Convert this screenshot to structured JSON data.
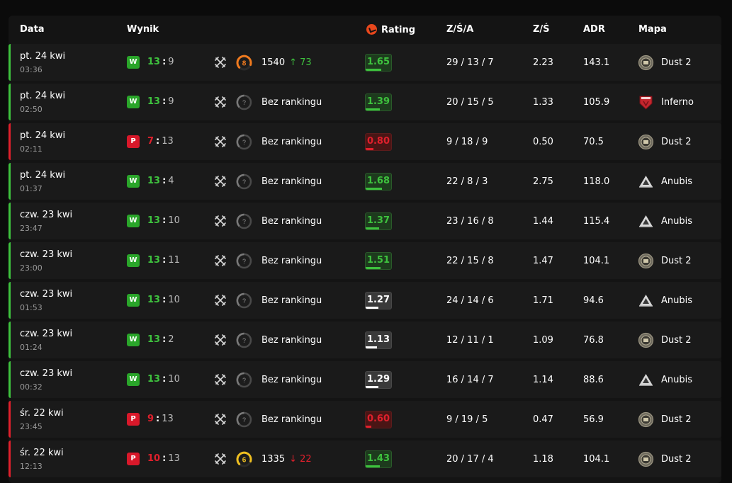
{
  "header": {
    "date": "Data",
    "result": "Wynik",
    "rating": "Rating",
    "kda": "Z/Ś/A",
    "kd": "Z/Ś",
    "adr": "ADR",
    "map": "Mapa"
  },
  "colors": {
    "win": "#3ec23e",
    "loss": "#e0202c",
    "rank_8": "#f07a1e",
    "rank_6": "#f0c020",
    "background": "#0b0b0b",
    "row": "#1a1a1a"
  },
  "matches": [
    {
      "outcome": "win",
      "badge": "W",
      "date": "pt. 24 kwi",
      "time": "03:36",
      "own": "13",
      "opp": "9",
      "ranked": true,
      "rank_level": "8",
      "elo": "1540",
      "elo_change": "↑ 73",
      "elo_dir": "up",
      "rating": "1.65",
      "rating_class": "good",
      "rating_fill": 0.62,
      "kda": "29 / 13 / 7",
      "kd": "2.23",
      "adr": "143.1",
      "map": "Dust 2",
      "map_icon": "dust2-icon"
    },
    {
      "outcome": "win",
      "badge": "W",
      "date": "pt. 24 kwi",
      "time": "02:50",
      "own": "13",
      "opp": "9",
      "ranked": false,
      "rank_text": "Bez rankingu",
      "rating": "1.39",
      "rating_class": "good",
      "rating_fill": 0.55,
      "kda": "20 / 15 / 5",
      "kd": "1.33",
      "adr": "105.9",
      "map": "Inferno",
      "map_icon": "inferno-icon"
    },
    {
      "outcome": "loss",
      "badge": "P",
      "date": "pt. 24 kwi",
      "time": "02:11",
      "own": "7",
      "opp": "13",
      "ranked": false,
      "rank_text": "Bez rankingu",
      "rating": "0.80",
      "rating_class": "bad",
      "rating_fill": 0.3,
      "kda": "9 / 18 / 9",
      "kd": "0.50",
      "adr": "70.5",
      "map": "Dust 2",
      "map_icon": "dust2-icon"
    },
    {
      "outcome": "win",
      "badge": "W",
      "date": "pt. 24 kwi",
      "time": "01:37",
      "own": "13",
      "opp": "4",
      "ranked": false,
      "rank_text": "Bez rankingu",
      "rating": "1.68",
      "rating_class": "good",
      "rating_fill": 0.63,
      "kda": "22 / 8 / 3",
      "kd": "2.75",
      "adr": "118.0",
      "map": "Anubis",
      "map_icon": "anubis-icon"
    },
    {
      "outcome": "win",
      "badge": "W",
      "date": "czw. 23 kwi",
      "time": "23:47",
      "own": "13",
      "opp": "10",
      "ranked": false,
      "rank_text": "Bez rankingu",
      "rating": "1.37",
      "rating_class": "good",
      "rating_fill": 0.54,
      "kda": "23 / 16 / 8",
      "kd": "1.44",
      "adr": "115.4",
      "map": "Anubis",
      "map_icon": "anubis-icon"
    },
    {
      "outcome": "win",
      "badge": "W",
      "date": "czw. 23 kwi",
      "time": "23:00",
      "own": "13",
      "opp": "11",
      "ranked": false,
      "rank_text": "Bez rankingu",
      "rating": "1.51",
      "rating_class": "good",
      "rating_fill": 0.58,
      "kda": "22 / 15 / 8",
      "kd": "1.47",
      "adr": "104.1",
      "map": "Dust 2",
      "map_icon": "dust2-icon"
    },
    {
      "outcome": "win",
      "badge": "W",
      "date": "czw. 23 kwi",
      "time": "01:53",
      "own": "13",
      "opp": "10",
      "ranked": false,
      "rank_text": "Bez rankingu",
      "rating": "1.27",
      "rating_class": "neutral",
      "rating_fill": 0.5,
      "kda": "24 / 14 / 6",
      "kd": "1.71",
      "adr": "94.6",
      "map": "Anubis",
      "map_icon": "anubis-icon"
    },
    {
      "outcome": "win",
      "badge": "W",
      "date": "czw. 23 kwi",
      "time": "01:24",
      "own": "13",
      "opp": "2",
      "ranked": false,
      "rank_text": "Bez rankingu",
      "rating": "1.13",
      "rating_class": "neutral",
      "rating_fill": 0.45,
      "kda": "12 / 11 / 1",
      "kd": "1.09",
      "adr": "76.8",
      "map": "Dust 2",
      "map_icon": "dust2-icon"
    },
    {
      "outcome": "win",
      "badge": "W",
      "date": "czw. 23 kwi",
      "time": "00:32",
      "own": "13",
      "opp": "10",
      "ranked": false,
      "rank_text": "Bez rankingu",
      "rating": "1.29",
      "rating_class": "neutral",
      "rating_fill": 0.5,
      "kda": "16 / 14 / 7",
      "kd": "1.14",
      "adr": "88.6",
      "map": "Anubis",
      "map_icon": "anubis-icon"
    },
    {
      "outcome": "loss",
      "badge": "P",
      "date": "śr. 22 kwi",
      "time": "23:45",
      "own": "9",
      "opp": "13",
      "ranked": false,
      "rank_text": "Bez rankingu",
      "rating": "0.60",
      "rating_class": "bad",
      "rating_fill": 0.22,
      "kda": "9 / 19 / 5",
      "kd": "0.47",
      "adr": "56.9",
      "map": "Dust 2",
      "map_icon": "dust2-icon"
    },
    {
      "outcome": "loss",
      "badge": "P",
      "date": "śr. 22 kwi",
      "time": "12:13",
      "own": "10",
      "opp": "13",
      "ranked": true,
      "rank_level": "6",
      "elo": "1335",
      "elo_change": "↓ 22",
      "elo_dir": "down",
      "rating": "1.43",
      "rating_class": "good",
      "rating_fill": 0.56,
      "kda": "20 / 17 / 4",
      "kd": "1.18",
      "adr": "104.1",
      "map": "Dust 2",
      "map_icon": "dust2-icon"
    }
  ]
}
